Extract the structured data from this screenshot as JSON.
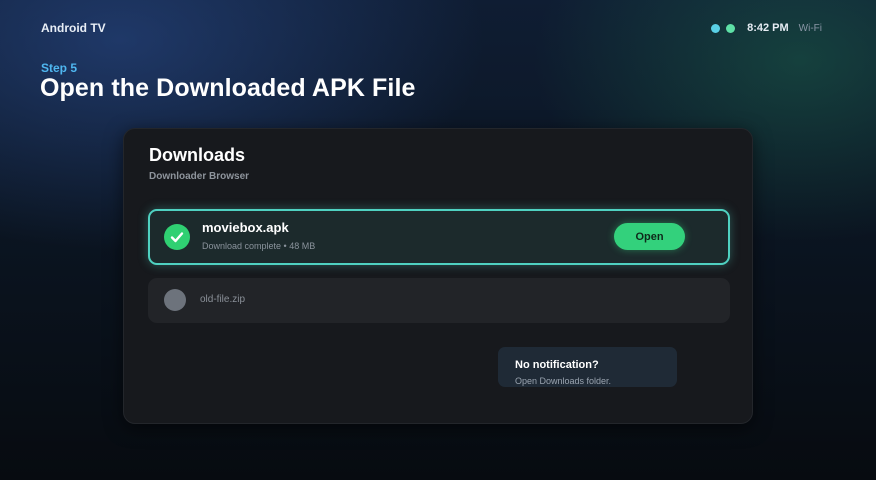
{
  "topbar": {
    "brand": "Android TV",
    "status_dots": [
      "#5ad0e6",
      "#5ee0a6"
    ],
    "time": "8:42 PM",
    "network": "Wi-Fi"
  },
  "header": {
    "step": "Step 5",
    "title": "Open the Downloaded APK File"
  },
  "panel": {
    "title": "Downloads",
    "subtitle": "Downloader Browser",
    "files": [
      {
        "name": "moviebox.apk",
        "meta": "Download complete • 48 MB",
        "status_icon": "check-icon",
        "action_label": "Open",
        "selected": true
      },
      {
        "name": "old-file.zip",
        "status_icon": "gray-dot-icon",
        "selected": false
      }
    ],
    "hint": {
      "title": "No notification?",
      "text": "Open Downloads folder."
    }
  },
  "colors": {
    "accent_teal": "#4fd1c1",
    "success_green": "#33d17c",
    "step_blue": "#4fb7f0"
  }
}
